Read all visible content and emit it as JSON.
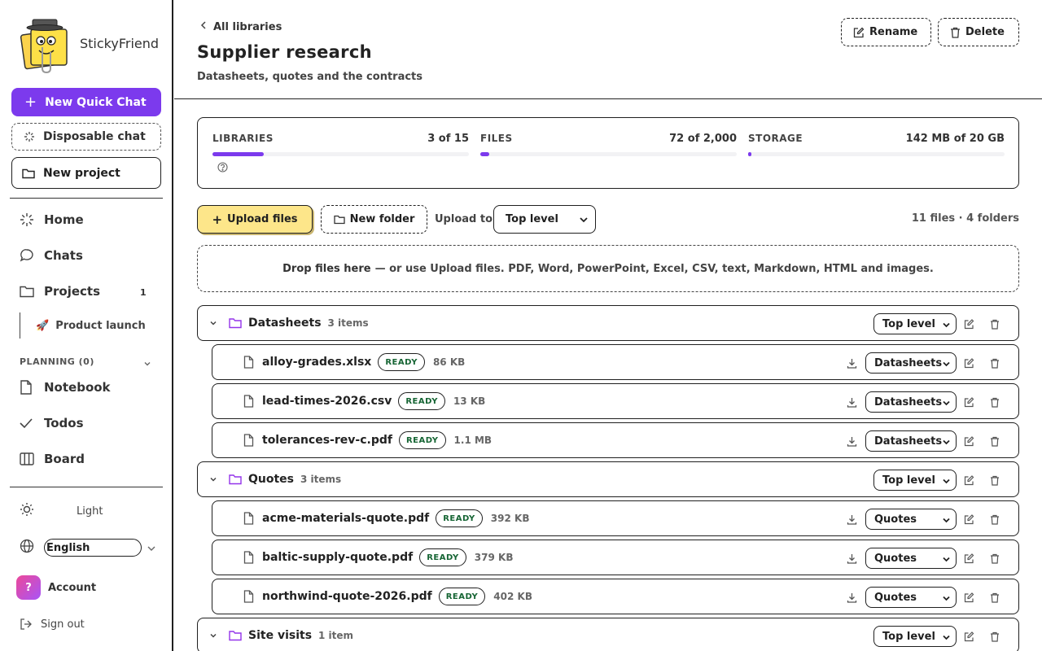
{
  "app": {
    "name": "StickyFriend"
  },
  "sidebar": {
    "new_quick_chat": "New Quick Chat",
    "disposable_chat": "Disposable chat",
    "new_project": "New project",
    "nav": [
      {
        "label": "Home"
      },
      {
        "label": "Chats"
      },
      {
        "label": "Projects",
        "badge": "1"
      }
    ],
    "project_item": {
      "emoji": "🚀",
      "label": "Product launch"
    },
    "planning_label": "PLANNING (0)",
    "planning": [
      {
        "label": "Notebook"
      },
      {
        "label": "Todos"
      },
      {
        "label": "Board"
      }
    ],
    "theme_label": "Light",
    "language": "English",
    "account_initial": "?",
    "account_label": "Account",
    "signout": "Sign out"
  },
  "header": {
    "back": "All libraries",
    "title": "Supplier research",
    "subtitle": "Datasheets, quotes and the contracts",
    "rename": "Rename",
    "delete": "Delete"
  },
  "usage": [
    {
      "label": "LIBRARIES",
      "value": "3 of 15",
      "fraction": 0.2
    },
    {
      "label": "FILES",
      "value": "72 of 2,000",
      "fraction": 0.036
    },
    {
      "label": "STORAGE",
      "value": "142 MB of 20 GB",
      "fraction": 0.007
    }
  ],
  "toolbar": {
    "upload": "Upload files",
    "new_folder": "New folder",
    "upload_to_label": "Upload to",
    "upload_to_value": "Top level",
    "counts": "11 files · 4 folders"
  },
  "dropzone": {
    "strong": "Drop files here",
    "rest": "— or use Upload files. PDF, Word, PowerPoint, Excel, CSV, text, Markdown, HTML and images."
  },
  "tree": {
    "ready_label": "READY",
    "folders": [
      {
        "name": "Datasheets",
        "count": "3 items",
        "location": "Top level",
        "files": [
          {
            "name": "alloy-grades.xlsx",
            "size": "86 KB",
            "location": "Datasheets"
          },
          {
            "name": "lead-times-2026.csv",
            "size": "13 KB",
            "location": "Datasheets"
          },
          {
            "name": "tolerances-rev-c.pdf",
            "size": "1.1 MB",
            "location": "Datasheets"
          }
        ]
      },
      {
        "name": "Quotes",
        "count": "3 items",
        "location": "Top level",
        "files": [
          {
            "name": "acme-materials-quote.pdf",
            "size": "392 KB",
            "location": "Quotes"
          },
          {
            "name": "baltic-supply-quote.pdf",
            "size": "379 KB",
            "location": "Quotes"
          },
          {
            "name": "northwind-quote-2026.pdf",
            "size": "402 KB",
            "location": "Quotes"
          }
        ]
      },
      {
        "name": "Site visits",
        "count": "1 item",
        "location": "Top level",
        "files": []
      }
    ]
  },
  "colors": {
    "accent": "#7c3aed",
    "upload_bg": "#fde68a",
    "ready_text": "#166534"
  }
}
